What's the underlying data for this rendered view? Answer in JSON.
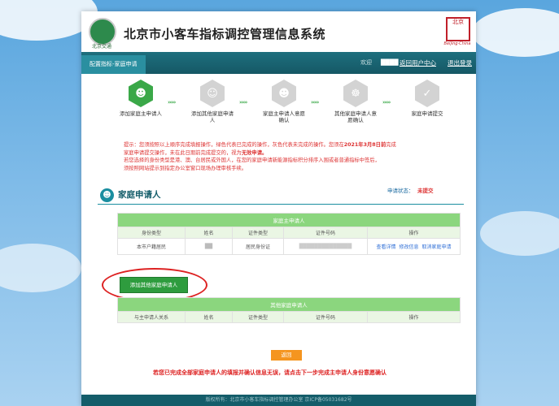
{
  "header": {
    "logo_text": "北京交通",
    "title": "北京市小客车指标调控管理信息系统",
    "seal_text": "北京",
    "seal_sub": "Beijing·China"
  },
  "nav": {
    "tab": "配置指标-家庭申请",
    "welcome": "欢迎",
    "user": "████",
    "back": "返回用户中心",
    "logout": "退出登录"
  },
  "steps": [
    {
      "label": "添加家庭主申请人",
      "state": "active"
    },
    {
      "label": "添加其他家庭申请人",
      "state": "inactive"
    },
    {
      "label": "家庭主申请人意愿确认",
      "state": "inactive"
    },
    {
      "label": "其他家庭申请人意愿确认",
      "state": "inactive"
    },
    {
      "label": "家庭申请提交",
      "state": "inactive"
    }
  ],
  "step_arrows": "›››››",
  "notice": {
    "line1a": "提示：您须按照以上顺序完成填报操作，绿色代表已完成的操作，灰色代表未完成的操作。您须在",
    "line1b": "2021年3月8日前",
    "line1c": "完成",
    "line2a": "家庭申请提交操作，未在此日期前完成提交的，视为",
    "line2b": "无效申请。",
    "line3": "若您选择的身份类型是港、澳、台居民或外国人，在您的家庭申请新能源指标积分排序入围或者普通指标中签后，",
    "line4": "须按照网站提示到指定办公室窗口现场办理审核手续。"
  },
  "section": {
    "title": "家庭申请人",
    "status_label": "申请状态：",
    "status_value": "未提交"
  },
  "main_table": {
    "title": "家庭主申请人",
    "headers": [
      "身份类型",
      "姓名",
      "证件类型",
      "证件号码",
      "操作"
    ],
    "row": [
      "本市户籍居民",
      "██",
      "居民身份证",
      "██████████████",
      ""
    ],
    "actions": [
      "查看详情",
      "修改信息",
      "取消家庭申请"
    ]
  },
  "add_button": "添加其他家庭申请人",
  "other_table": {
    "title": "其他家庭申请人",
    "headers": [
      "与主申请人关系",
      "姓名",
      "证件类型",
      "证件号码",
      "操作"
    ]
  },
  "return_button": "返回",
  "footer_note": "若您已完成全部家庭申请人的填报并确认信息无误，请点击下一步完成主申请人身份意愿确认",
  "footer": "版权所有：北京市小客车指标调控管理办公室  京ICP备05031682号"
}
